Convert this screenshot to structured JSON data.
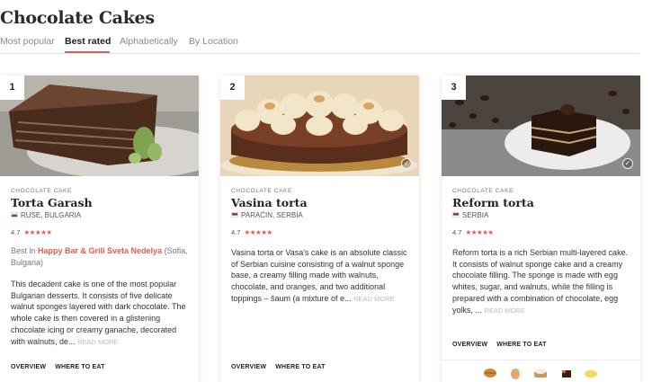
{
  "header": {
    "title": "Chocolate Cakes"
  },
  "tabs": [
    {
      "label": "Most popular"
    },
    {
      "label": "Best rated"
    },
    {
      "label": "Alphabetically"
    },
    {
      "label": "By Location"
    }
  ],
  "cards": [
    {
      "rank": "1",
      "category": "CHOCOLATE CAKE",
      "name": "Torta Garash",
      "location": "RUSE, BULGARIA",
      "rating": "4.7",
      "stars": "★★★★★",
      "best_in_prefix": "Best in ",
      "best_in_place": "Happy Bar & Grill Sveta Nedelya",
      "best_in_suffix": " (Sofia, Bulgaria)",
      "description": "This decadent cake is one of the most popular Bulgarian desserts. It consists of five delicate walnut sponges layered with dark chocolate. The whole cake is then covered in a glistening chocolate icing or creamy ganache, decorated with walnuts, de...",
      "read_more": "READ MORE",
      "overview": "OVERVIEW",
      "where_to_eat": "WHERE TO EAT"
    },
    {
      "rank": "2",
      "category": "CHOCOLATE CAKE",
      "name": "Vasina torta",
      "location": "PARAĆIN, SERBIA",
      "rating": "4.7",
      "stars": "★★★★★",
      "description": "Vasina torta or Vasa's cake is an absolute classic of Serbian cuisine consisting of a walnut sponge base, a creamy filling made with walnuts, chocolate, and oranges, and two additional toppings – šaum (a mixture of e...",
      "read_more": "READ MORE",
      "overview": "OVERVIEW",
      "where_to_eat": "WHERE TO EAT"
    },
    {
      "rank": "3",
      "category": "CHOCOLATE CAKE",
      "name": "Reform torta",
      "location": "SERBIA",
      "rating": "4.7",
      "stars": "★★★★★",
      "description": "Reform torta is a rich Serbian multi-layered cake. It consists of walnut sponge cake and a creamy chocolate filling. The sponge is made with egg whites, sugar, and walnuts, while the filling is prepared with a combination of chocolate, egg yolks, ...",
      "read_more": "READ MORE",
      "overview": "OVERVIEW",
      "where_to_eat": "WHERE TO EAT",
      "ingredients": [
        "walnut-icon",
        "egg-icon",
        "sugar-icon",
        "chocolate-icon",
        "butter-icon"
      ]
    }
  ],
  "colors": {
    "accent": "#e85a4f",
    "title": "#2b2b2b"
  }
}
